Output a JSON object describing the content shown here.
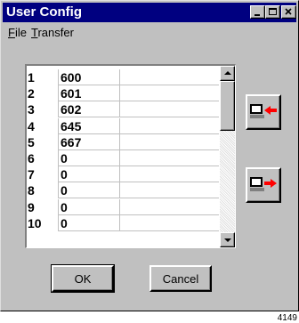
{
  "window": {
    "title": "User Config",
    "controls": {
      "minimize": "minimize",
      "maximize": "maximize",
      "close": "close"
    }
  },
  "menu": {
    "file": {
      "underlined": "F",
      "rest": "ile"
    },
    "transfer": {
      "underlined": "T",
      "rest": "ransfer"
    }
  },
  "list": {
    "rows": [
      {
        "num": "1",
        "value": "600"
      },
      {
        "num": "2",
        "value": "601"
      },
      {
        "num": "3",
        "value": "602"
      },
      {
        "num": "4",
        "value": "645"
      },
      {
        "num": "5",
        "value": "667"
      },
      {
        "num": "6",
        "value": "0"
      },
      {
        "num": "7",
        "value": "0"
      },
      {
        "num": "8",
        "value": "0"
      },
      {
        "num": "9",
        "value": "0"
      },
      {
        "num": "10",
        "value": "0"
      }
    ]
  },
  "transfer_buttons": {
    "upload_icon": "computer-with-left-arrow-icon",
    "download_icon": "computer-with-right-arrow-icon",
    "arrow_color": "#ff0000"
  },
  "buttons": {
    "ok": "OK",
    "cancel": "Cancel"
  },
  "figure_number": "4149"
}
